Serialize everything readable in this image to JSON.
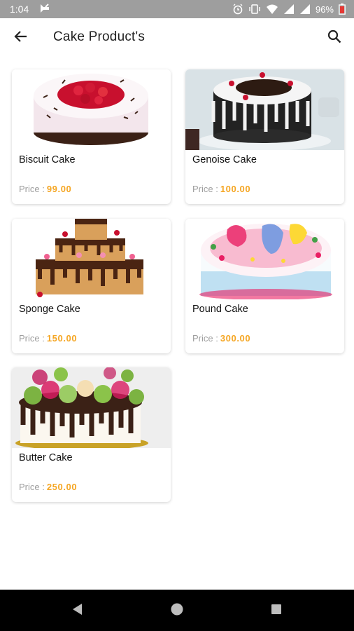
{
  "status_bar": {
    "time": "1:04",
    "battery_percent": "96%",
    "icons": [
      "app-notification-icon",
      "alarm-icon",
      "vibrate-icon",
      "wifi-icon",
      "signal-icon",
      "signal-icon",
      "battery-icon"
    ]
  },
  "app_bar": {
    "title": "Cake Product's",
    "back_icon": "arrow-left-icon",
    "search_icon": "search-icon"
  },
  "products": [
    {
      "name": "Biscuit Cake",
      "price_label": "Price :",
      "price": "99.00"
    },
    {
      "name": "Genoise Cake",
      "price_label": "Price :",
      "price": "100.00"
    },
    {
      "name": "Sponge Cake",
      "price_label": "Price :",
      "price": "150.00"
    },
    {
      "name": "Pound Cake",
      "price_label": "Price :",
      "price": "300.00"
    },
    {
      "name": "Butter Cake",
      "price_label": "Price :",
      "price": "250.00"
    }
  ],
  "colors": {
    "status_bar": "#9e9e9e",
    "price_accent": "#f5a623",
    "price_label": "#9e9e9e",
    "nav_bar": "#000000"
  },
  "nav_bar": {
    "buttons": [
      "back-triangle-icon",
      "home-circle-icon",
      "recents-square-icon"
    ]
  }
}
